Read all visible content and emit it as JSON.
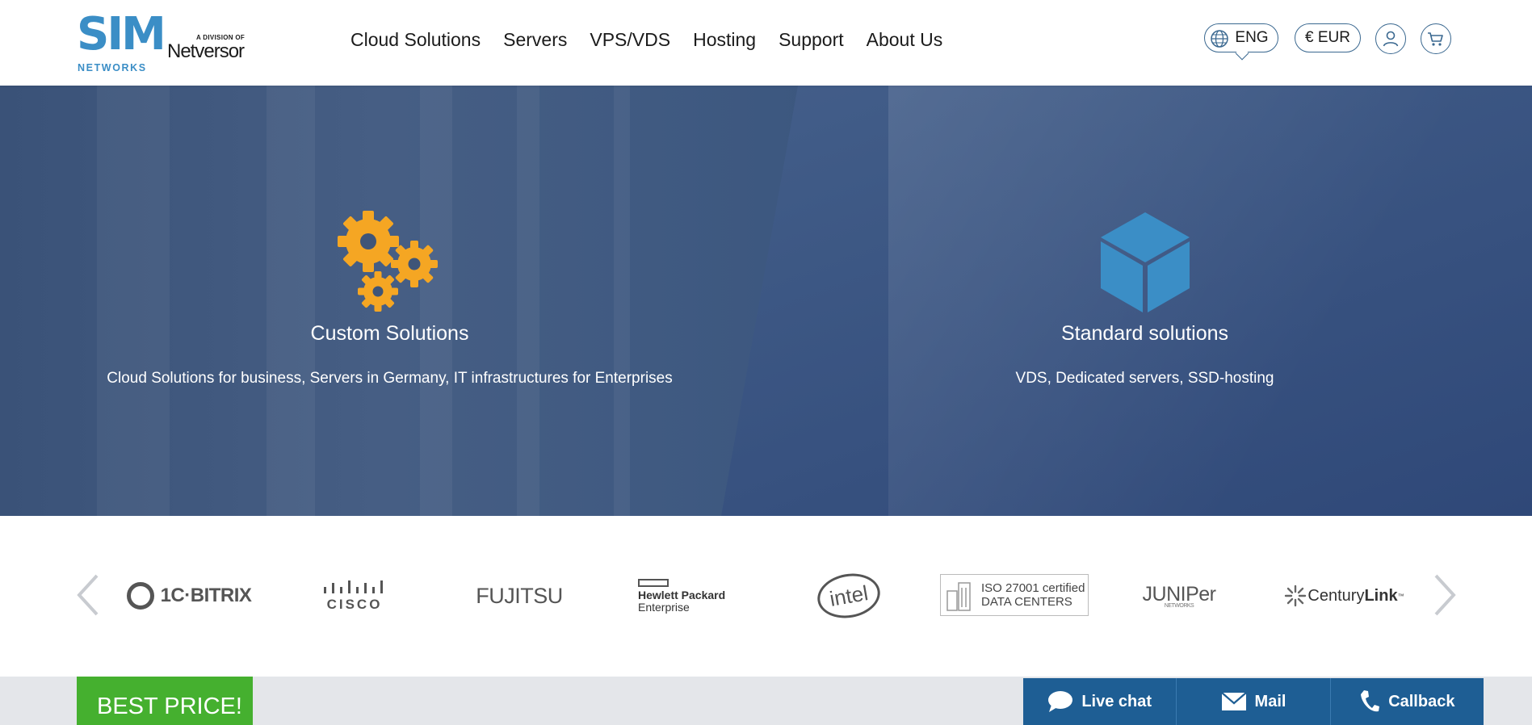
{
  "brand": {
    "logo_main": "SIM",
    "logo_sub": "NETWORKS",
    "division_label": "A DIVISION OF",
    "division_name": "Netversor"
  },
  "nav": {
    "items": [
      {
        "label": "Cloud Solutions"
      },
      {
        "label": "Servers"
      },
      {
        "label": "VPS/VDS"
      },
      {
        "label": "Hosting"
      },
      {
        "label": "Support"
      },
      {
        "label": "About Us"
      }
    ]
  },
  "header_tools": {
    "language": "ENG",
    "currency": "€ EUR",
    "user_icon": "user-icon",
    "cart_icon": "cart-icon"
  },
  "hero": {
    "left": {
      "icon": "gears-icon",
      "title": "Custom Solutions",
      "subtitle": "Cloud Solutions for business, Servers in Germany, IT infrastructures for Enterprises"
    },
    "right": {
      "icon": "cube-icon",
      "title": "Standard solutions",
      "subtitle": "VDS, Dedicated servers, SSD-hosting"
    }
  },
  "partners": {
    "bitrix": "1C·BITRIX",
    "cisco": "CISCO",
    "fujitsu": "FUJITSU",
    "hpe_line1": "Hewlett Packard",
    "hpe_line2": "Enterprise",
    "intel": "intel",
    "iso_line1": "ISO 27001 certified",
    "iso_line2": "DATA CENTERS",
    "juniper": "JUNIPer",
    "juniper_sub": "NETWORKS",
    "century_a": "Century",
    "century_b": "Link",
    "century_tm": "™"
  },
  "promo": {
    "best_price": "BEST PRICE!"
  },
  "contact": {
    "live_chat": "Live chat",
    "mail": "Mail",
    "callback": "Callback"
  },
  "colors": {
    "brand_blue": "#3b8ec6",
    "accent_orange": "#f5a623",
    "hero_blue": "#3f5a86",
    "green": "#45b02f",
    "contact_bar": "#1e5e94"
  }
}
